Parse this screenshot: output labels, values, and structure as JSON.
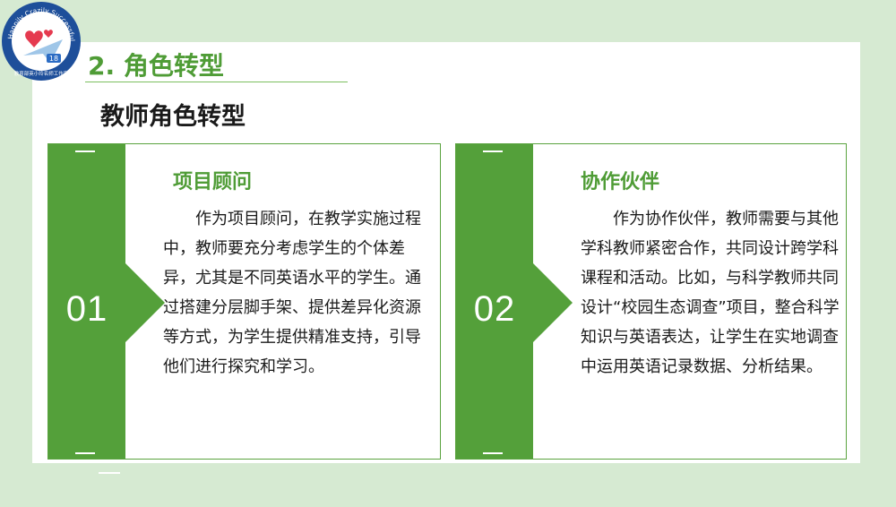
{
  "logo": {
    "arc_text": "Happily Crazily Successfully",
    "bottom_text": "教育部英小玲名师工作室",
    "badge_text": "18"
  },
  "header": {
    "section_title": "2. 角色转型",
    "subtitle": "教师角色转型"
  },
  "cards": [
    {
      "number": "01",
      "title": "项目顾问",
      "body": "　　作为项目顾问，在教学实施过程中，教师要充分考虑学生的个体差异，尤其是不同英语水平的学生。通过搭建分层脚手架、提供差异化资源等方式，为学生提供精准支持，引导他们进行探究和学习。"
    },
    {
      "number": "02",
      "title": "协作伙伴",
      "body": "　　作为协作伙伴，教师需要与其他学科教师紧密合作，共同设计跨学科课程和活动。比如，与科学教师共同设计“校园生态调查”项目，整合科学知识与英语表达，让学生在实地调查中运用英语记录数据、分析结果。"
    }
  ],
  "colors": {
    "accent": "#54a03a",
    "title_green": "#4f9c36",
    "background": "#d6ead2"
  }
}
